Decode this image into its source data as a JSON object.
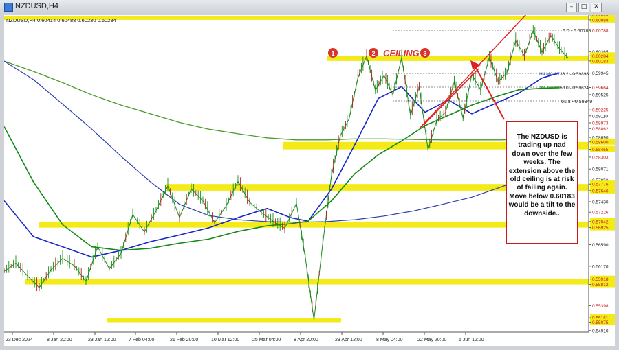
{
  "window": {
    "title": "NZDUSD,H4",
    "buttons": [
      "minimize",
      "maximize",
      "close"
    ]
  },
  "header": {
    "symbol_line": "NZDUSD,H4  0.60414 0.60488 0.60230 0.60234"
  },
  "annotations": {
    "ceiling_label": "CEILING",
    "markers": [
      "1",
      "2",
      "3"
    ],
    "note": "The NZDUSD is trading up nad down over the few weeks.  The extension above the old ceiling is at risk of failing again.  Move below 0.60183 would be a tilt to the downside.."
  },
  "levels": {
    "fib_0": "0.0 - 0.60788",
    "fib_382": "38.2 - 0.59898",
    "fib_50": "50.0 - 0.59624",
    "fib_618": "61.8 - 0.59349",
    "ma100": "H4 MA:10",
    "ma200": "100 300 200"
  },
  "colors": {
    "price": "#1a8a1a",
    "ma_blue": "#1525c8",
    "ma_green": "#138a13",
    "ma_olive": "#4a9a2a",
    "ma_slate": "#2a3fb0",
    "zone": "#f3ea17",
    "trend": "#e02020",
    "marker": "#d9342b"
  },
  "chart_data": {
    "type": "line",
    "title": "NZDUSD,H4",
    "xlabel": "",
    "ylabel": "",
    "x_ticks": [
      "23 Dec 2024",
      "8 Jan 20:00",
      "23 Jan 12:00",
      "7 Feb 04:00",
      "21 Feb 20:00",
      "10 Mar 12:00",
      "25 Mar 04:00",
      "8 Apr 20:00",
      "23 Apr 12:00",
      "8 May 04:00",
      "22 May 20:00",
      "6 Jun 12:00"
    ],
    "y_ticks": [
      0.61063,
      0.60988,
      0.60788,
      0.60365,
      0.60284,
      0.60183,
      0.59945,
      0.59664,
      0.59525,
      0.59225,
      0.5911,
      0.58973,
      0.58862,
      0.5869,
      0.586,
      0.58455,
      0.58303,
      0.58071,
      0.5785,
      0.57776,
      0.57646,
      0.5743,
      0.57226,
      0.57042,
      0.56925,
      0.5659,
      0.5617,
      0.55918,
      0.55812,
      0.55398,
      0.55161,
      0.55075,
      0.5491
    ],
    "ylim": [
      0.5488,
      0.6108
    ],
    "grid": false,
    "series": [
      {
        "name": "",
        "x": [
          0,
          4,
          8,
          12,
          16,
          20,
          24,
          28,
          32,
          36,
          40,
          44,
          48,
          52,
          56,
          60,
          64,
          68,
          72,
          76,
          80,
          84,
          88,
          92,
          96,
          100,
          103,
          106,
          109,
          112,
          115,
          118,
          121,
          124,
          127,
          130,
          133,
          136,
          139,
          142,
          145,
          148,
          151,
          154,
          157,
          160,
          163,
          166,
          169,
          172,
          175,
          178,
          181,
          184,
          187,
          190,
          193
        ],
        "values": [
          0.5607,
          0.5623,
          0.5598,
          0.5575,
          0.561,
          0.5632,
          0.5618,
          0.5587,
          0.5655,
          0.5612,
          0.5642,
          0.5718,
          0.5684,
          0.5726,
          0.5774,
          0.5712,
          0.5768,
          0.5745,
          0.5702,
          0.5735,
          0.5783,
          0.5742,
          0.5722,
          0.5705,
          0.5691,
          0.574,
          0.5635,
          0.5512,
          0.5662,
          0.5795,
          0.5872,
          0.5905,
          0.5985,
          0.6028,
          0.5961,
          0.599,
          0.5952,
          0.6025,
          0.5912,
          0.5968,
          0.5845,
          0.5902,
          0.5918,
          0.5978,
          0.5906,
          0.5992,
          0.5962,
          0.6026,
          0.5978,
          0.5995,
          0.6058,
          0.6028,
          0.6078,
          0.6035,
          0.6068,
          0.6042,
          0.6024
        ]
      },
      {
        "name": "",
        "x": [
          0,
          10,
          20,
          30,
          40,
          50,
          60,
          70,
          80,
          90,
          98,
          104,
          112,
          120,
          128,
          136,
          144,
          152,
          160,
          168,
          176,
          184,
          190
        ],
        "values": [
          0.5745,
          0.5675,
          0.5655,
          0.5635,
          0.5648,
          0.5665,
          0.5678,
          0.5692,
          0.5712,
          0.573,
          0.5712,
          0.5705,
          0.5768,
          0.5855,
          0.5945,
          0.5968,
          0.5918,
          0.5942,
          0.5915,
          0.5935,
          0.5955,
          0.5985,
          0.5995
        ]
      },
      {
        "name": "",
        "x": [
          0,
          10,
          20,
          30,
          40,
          50,
          60,
          70,
          80,
          90,
          98,
          104,
          112,
          120,
          128,
          136,
          144,
          152,
          160,
          168,
          176,
          184,
          190
        ],
        "values": [
          0.589,
          0.5782,
          0.5698,
          0.5655,
          0.5648,
          0.5652,
          0.5662,
          0.567,
          0.5685,
          0.5696,
          0.57,
          0.5705,
          0.5745,
          0.5798,
          0.5835,
          0.5862,
          0.5892,
          0.5912,
          0.5932,
          0.5948,
          0.5962,
          0.5965,
          0.5966
        ]
      },
      {
        "name": "",
        "x": [
          0,
          10,
          20,
          30,
          40,
          50,
          60,
          70,
          80,
          90,
          100,
          110,
          120,
          130,
          140,
          150,
          160,
          170,
          180,
          190
        ],
        "values": [
          0.6018,
          0.5998,
          0.5976,
          0.5952,
          0.5932,
          0.5915,
          0.5898,
          0.5885,
          0.5876,
          0.5868,
          0.5864,
          0.5864,
          0.5866,
          0.5866,
          0.5865,
          0.5864,
          0.5864,
          0.5864,
          0.5866,
          0.5869
        ]
      },
      {
        "name": "",
        "x": [
          0,
          10,
          20,
          30,
          40,
          50,
          60,
          70,
          80,
          90,
          100,
          110,
          120,
          130,
          140,
          150,
          160,
          170,
          180,
          190
        ],
        "values": [
          0.6018,
          0.5982,
          0.5934,
          0.5885,
          0.5832,
          0.5782,
          0.5738,
          0.5716,
          0.5708,
          0.5704,
          0.5703,
          0.5704,
          0.5708,
          0.5715,
          0.5725,
          0.5738,
          0.5752,
          0.5772,
          0.5792,
          0.5807
        ]
      }
    ],
    "zones": [
      {
        "from": 0.61063,
        "to": 0.60988
      },
      {
        "from": 0.60284,
        "to": 0.60183
      },
      {
        "from": 0.586,
        "to": 0.58455
      },
      {
        "from": 0.57776,
        "to": 0.57646
      },
      {
        "from": 0.57042,
        "to": 0.56925
      },
      {
        "from": 0.55918,
        "to": 0.55812
      },
      {
        "from": 0.55161,
        "to": 0.55075
      }
    ]
  }
}
